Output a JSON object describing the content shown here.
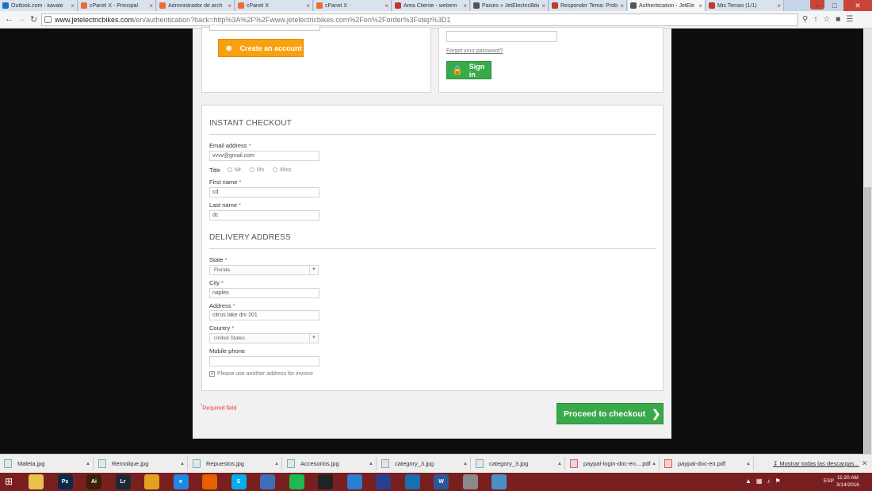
{
  "browser": {
    "tabs": [
      {
        "label": "Outlook.com - kavale",
        "icon_color": "#1f6fc5",
        "icon": "o"
      },
      {
        "label": "cPanel X - Principal",
        "icon_color": "#f06a35",
        "icon": "c"
      },
      {
        "label": "Administrador de arch",
        "icon_color": "#f06a35",
        "icon": "c"
      },
      {
        "label": "cPanel X",
        "icon_color": "#f06a35",
        "icon": "c"
      },
      {
        "label": "cPanel X",
        "icon_color": "#f06a35",
        "icon": "c"
      },
      {
        "label": "Área Cliente - webem",
        "icon_color": "#c0392b",
        "icon": "w"
      },
      {
        "label": "Paises « JetElectricBike",
        "icon_color": "#555555",
        "icon": "j"
      },
      {
        "label": "Responder Tema: Prob",
        "icon_color": "#c0392b",
        "icon": "w"
      },
      {
        "label": "Authentication - JetEle",
        "icon_color": "#555555",
        "icon": "j",
        "active": true
      },
      {
        "label": "Mis Temas (1/1)",
        "icon_color": "#c0392b",
        "icon": "w"
      }
    ],
    "url_host": "www.jetelectricbikes.com",
    "url_path": "/en/authentication?back=http%3A%2F%2Fwww.jetelectricbikes.com%2Fen%2Forder%3Fstep%3D1"
  },
  "auth": {
    "create_account_label": "Create an account",
    "forgot_password": "Forgot your password?",
    "sign_in_label": "Sign in"
  },
  "checkout": {
    "instant_heading": "Instant Checkout",
    "email_label": "Email address",
    "email_value": "vvvv@gmail.com",
    "title_label": "Title",
    "title_options": [
      "Mr.",
      "Ms.",
      "Miss"
    ],
    "first_name_label": "First name",
    "first_name_value": "cd",
    "last_name_label": "Last name",
    "last_name_value": "dc",
    "delivery_heading": "Delivery address",
    "state_label": "State",
    "state_value": "Florida",
    "city_label": "City",
    "city_value": "naples",
    "address_label": "Address",
    "address_value": "citrus lake drv 201",
    "country_label": "Country",
    "country_value": "United States",
    "mobile_label": "Mobile phone",
    "mobile_value": "",
    "invoice_checkbox_label": "Please use another address for invoice",
    "required_note": "Required field",
    "proceed_label": "Proceed to checkout"
  },
  "downloads": {
    "items": [
      {
        "name": "Maleta.jpg",
        "type": "jpg"
      },
      {
        "name": "Remolque.jpg",
        "type": "jpg"
      },
      {
        "name": "Repuestos.jpg",
        "type": "jpg"
      },
      {
        "name": "Accesorios.jpg",
        "type": "jpg"
      },
      {
        "name": "category_3.jpg",
        "type": "jpg"
      },
      {
        "name": "category_3.jpg",
        "type": "jpg"
      },
      {
        "name": "paypal-login-doc-en....pdf",
        "type": "pdf"
      },
      {
        "name": "paypal-doc-en.pdf",
        "type": "pdf"
      }
    ],
    "show_all": "Mostrar todas las descargas..."
  },
  "taskbar": {
    "apps": [
      {
        "name": "file-explorer",
        "label": "",
        "color": "#e8c24a"
      },
      {
        "name": "photoshop",
        "label": "Ps",
        "color": "#0b2a4a"
      },
      {
        "name": "illustrator",
        "label": "Ai",
        "color": "#3b2204"
      },
      {
        "name": "lightroom",
        "label": "Lr",
        "color": "#1b2a33"
      },
      {
        "name": "chrome",
        "label": "",
        "color": "#e0a21f",
        "active": true
      },
      {
        "name": "internet-explorer",
        "label": "e",
        "color": "#1e88e5"
      },
      {
        "name": "firefox",
        "label": "",
        "color": "#e66000"
      },
      {
        "name": "skype",
        "label": "S",
        "color": "#00aff0"
      },
      {
        "name": "app-blue",
        "label": "",
        "color": "#3d6fb6"
      },
      {
        "name": "spotify",
        "label": "",
        "color": "#1db954"
      },
      {
        "name": "app-dark",
        "label": "",
        "color": "#222222"
      },
      {
        "name": "app-circle",
        "label": "",
        "color": "#2a7fd4"
      },
      {
        "name": "app-crown",
        "label": "",
        "color": "#2a3f8f"
      },
      {
        "name": "app-ring",
        "label": "",
        "color": "#1a6fb0"
      },
      {
        "name": "word",
        "label": "W",
        "color": "#2b579a"
      },
      {
        "name": "app-paint",
        "label": "",
        "color": "#8a8a8a"
      },
      {
        "name": "app-folder",
        "label": "",
        "color": "#4a90c8"
      }
    ],
    "language": "ESP",
    "time": "11:20 AM",
    "date": "3/14/2016"
  }
}
